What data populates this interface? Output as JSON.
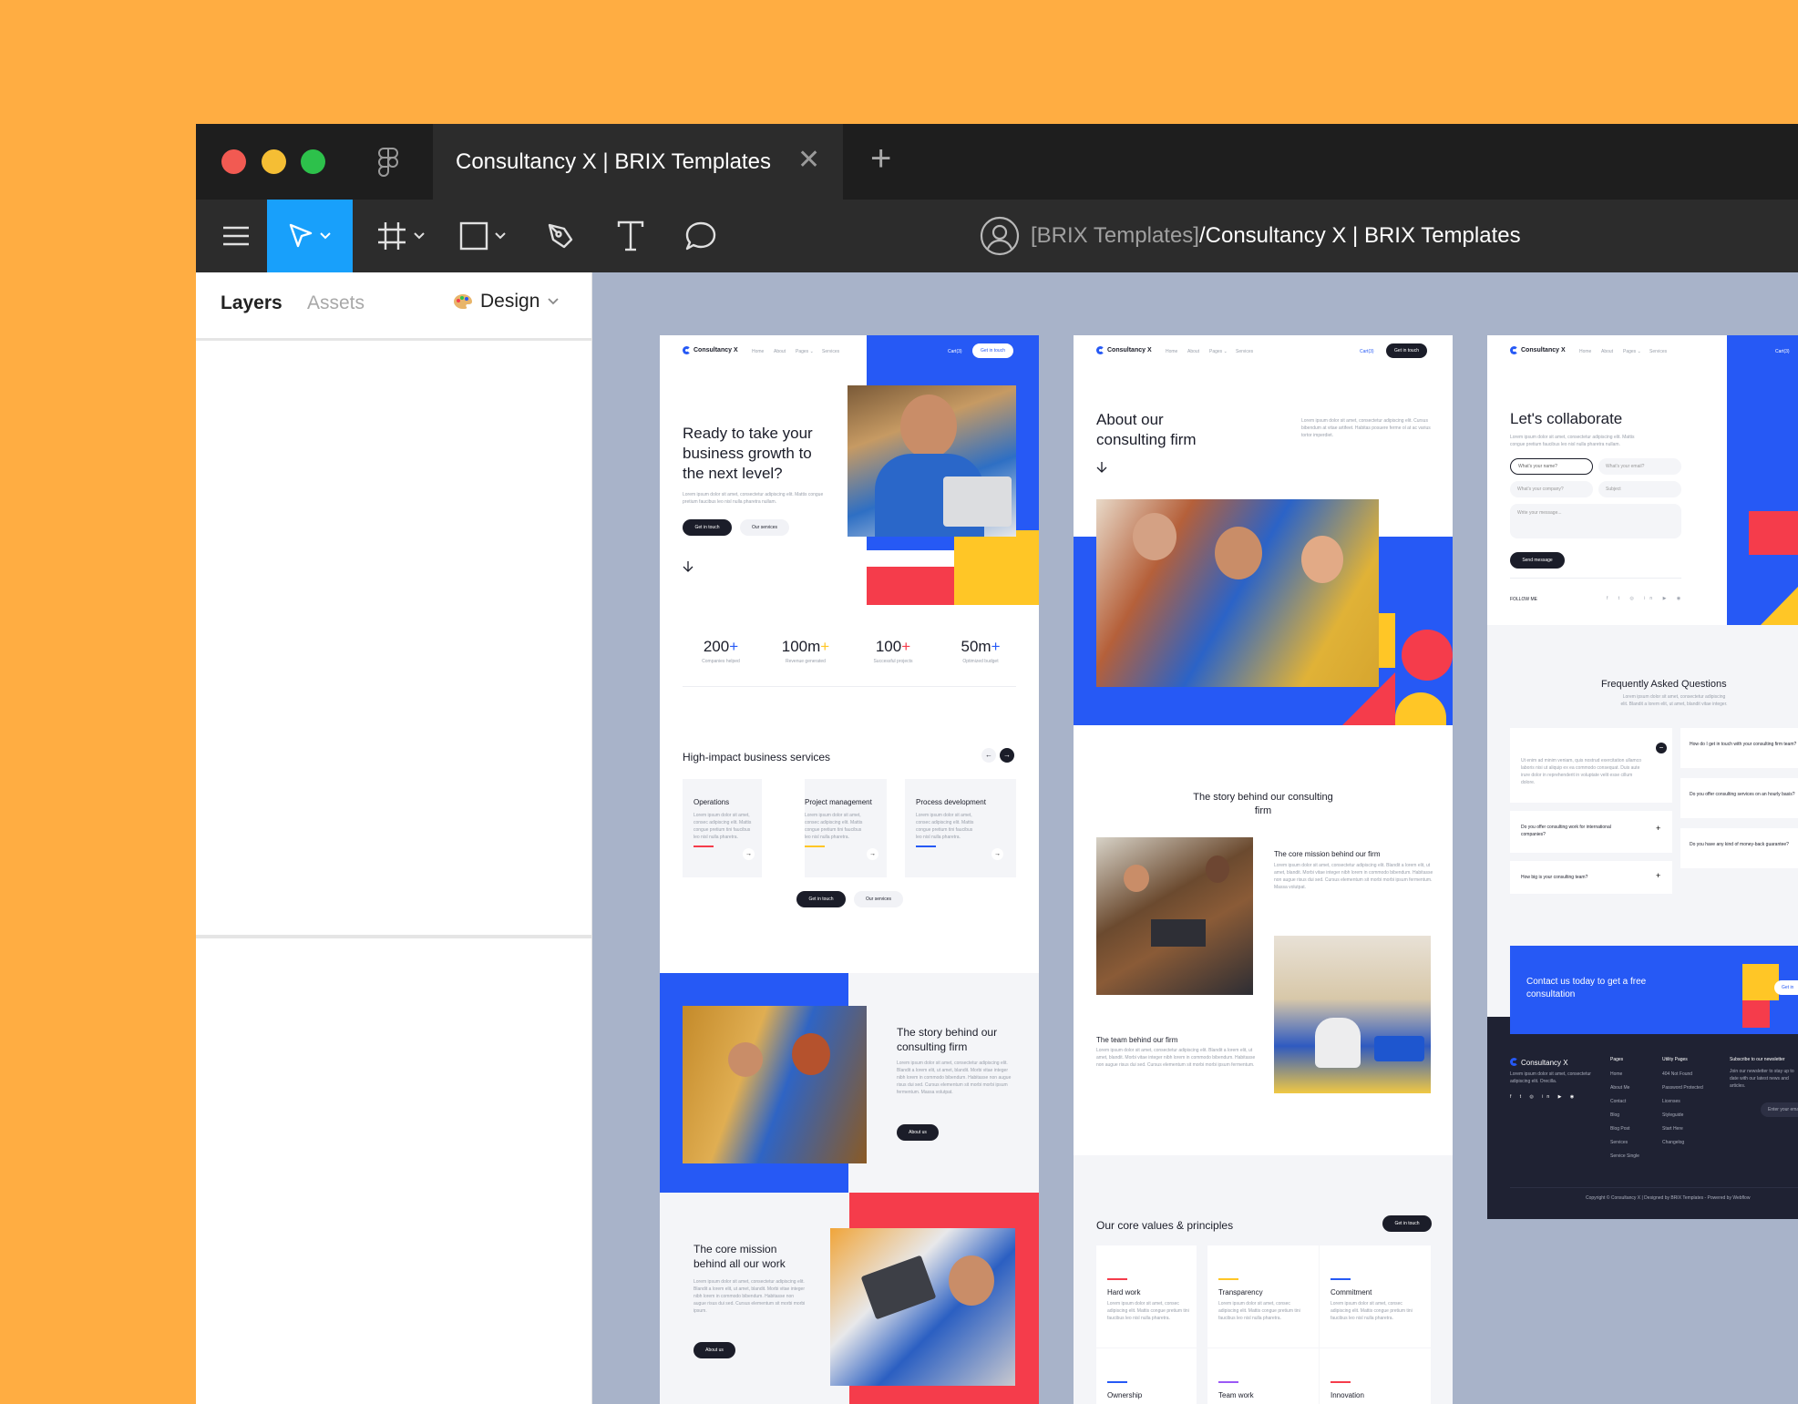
{
  "window": {
    "tab_title": "Consultancy X | BRIX Templates",
    "tab_close": "✕",
    "tab_add": "+"
  },
  "toolbar": {
    "breadcrumb_team": "[BRIX Templates]",
    "breadcrumb_file": "/Consultancy X | BRIX Templates"
  },
  "left_panel": {
    "tabs": [
      "Layers",
      "Assets"
    ],
    "design_label": "Design"
  },
  "frame1": {
    "brand": "Consultancy X",
    "nav": [
      "Home",
      "About",
      "Pages ⌄",
      "Services"
    ],
    "cart": "Cart(3)",
    "cta": "Get in touch",
    "hero_title": "Ready to take your business growth to the next level?",
    "hero_text": "Lorem ipsum dolor sit amet, consectetur adipiscing elit. Mattis congue pretium faucibus leo nisl nulla pharetra nullam.",
    "btn_primary": "Get in touch",
    "btn_secondary": "Our services",
    "stats": [
      {
        "value": "200",
        "suffix": "+",
        "label": "Companies helped"
      },
      {
        "value": "100m",
        "suffix": "+",
        "label": "Revenue generated"
      },
      {
        "value": "100",
        "suffix": "+",
        "label": "Successful projects"
      },
      {
        "value": "50m",
        "suffix": "+",
        "label": "Optimized budget"
      }
    ],
    "services_title": "High-impact business services",
    "services": [
      {
        "title": "Operations",
        "text": "Lorem ipsum dolor sit amet, consec adipiscing elit. Mattis congue pretium tini faucibus leo nisl nulla pharetra."
      },
      {
        "title": "Project management",
        "text": "Lorem ipsum dolor sit amet, consec adipiscing elit. Mattis congue pretium tini faucibus leo nisl nulla pharetra."
      },
      {
        "title": "Process development",
        "text": "Lorem ipsum dolor sit amet, consec adipiscing elit. Mattis congue pretium tini faucibus leo nisl nulla pharetra."
      }
    ],
    "services_btn_primary": "Get in touch",
    "services_btn_secondary": "Our services",
    "story_title": "The story behind our consulting firm",
    "story_text": "Lorem ipsum dolor sit amet, consectetur adipiscing elit. Blandit a lorem elit, ut amet, blandit. Morbi vitae integer nibh lorem in commodo bibendum. Habitasse non augue risus dui sed. Cursus elementum sit morbi morbi ipsum fermentum. Massa volutpat.",
    "story_btn": "About us",
    "mission_title": "The core mission behind all our work",
    "mission_text": "Lorem ipsum dolor sit amet, consectetur adipiscing elit. Blandit a lorem elit, ut amet, blandit. Morbi vitae integer nibh lorem in commodo bibendum. Habitasse non augue risus dui sed. Cursus elementum sit morbi morbi ipsum.",
    "mission_btn": "About us"
  },
  "frame2": {
    "brand": "Consultancy X",
    "nav": [
      "Home",
      "About",
      "Pages ⌄",
      "Services"
    ],
    "cart": "Cart(3)",
    "cta": "Get in touch",
    "title": "About our consulting firm",
    "intro": "Lorem ipsum dolor sit amet, consectetur adipiscing elit. Cursus bibendum at vitae artifeet. Habitas posuere ferme ol at ac varius tortor imperdiet.",
    "story_title": "The story behind our consulting firm",
    "mission_title": "The core mission behind our firm",
    "mission_text": "Lorem ipsum dolor sit amet, consectetur adipiscing elit. Blandit a lorem elit, ut amet, blandit. Morbi vitae integer nibh lorem in commodo bibendum. Habitasse non augue risus dui sed. Cursus elementum sit morbi morbi ipsum fermentum. Massa volutpat.",
    "team_title": "The team behind our firm",
    "team_text": "Lorem ipsum dolor sit amet, consectetur adipiscing elit. Blandit a lorem elit, ut amet, blandit. Morbi vitae integer nibh lorem in commodo bibendum. Habitasse non augue risus dui sed. Cursus elementum sit morbi morbi ipsum fermentum.",
    "values_title": "Our core values & principles",
    "values_btn": "Get in touch",
    "values": [
      {
        "title": "Hard work",
        "text": "Lorem ipsum dolor sit amet, consec adipiscing elit. Mattis congue pretium tini faucibus leo nisl nulla pharetra.",
        "color": "#F53C4B"
      },
      {
        "title": "Transparency",
        "text": "Lorem ipsum dolor sit amet, consec adipiscing elit. Mattis congue pretium tini faucibus leo nisl nulla pharetra.",
        "color": "#FFC626"
      },
      {
        "title": "Commitment",
        "text": "Lorem ipsum dolor sit amet, consec adipiscing elit. Mattis congue pretium tini faucibus leo nisl nulla pharetra.",
        "color": "#2659F5"
      },
      {
        "title": "Ownership",
        "color": "#2659F5"
      },
      {
        "title": "Team work",
        "color": "#9B59F5"
      },
      {
        "title": "Innovation",
        "color": "#F53C4B"
      }
    ]
  },
  "frame3": {
    "brand": "Consultancy X",
    "nav": [
      "Home",
      "About",
      "Pages ⌄",
      "Services"
    ],
    "cart": "Cart(3)",
    "title": "Let's collaborate",
    "intro": "Lorem ipsum dolor sit amet, consectetur adipiscing elit. Mattis congue pretium faucibus leo nisl nulla pharetra nullam.",
    "fields": [
      "What's your name?",
      "What's your email?",
      "What's your company?",
      "Subject",
      "Write your message..."
    ],
    "send_btn": "Send message",
    "follow": "FOLLOW ME",
    "faq_title": "Frequently Asked Questions",
    "faq_intro": "Lorem ipsum dolor sit amet, consectetur adipiscing elit. Blandit a lorem elit, ut amet, blandit vitae integer.",
    "faq_open_text": "Ut enim ad minim veniam, quis nostrud exercitation ullamco laboris nisi ut aliquip ex ea commodo consequat. Duis aute irure dolor in reprehenderit in voluptate velit esse cillum dolore.",
    "faq_left": [
      "Do you offer consulting work for international companies?",
      "How big is your consulting team?"
    ],
    "faq_right": [
      "How do I get in touch with your consulting firm team?",
      "Do you offer consulting services on an hourly basis?",
      "Do you have any kind of money-back guarantee?"
    ],
    "cta_title": "Contact us today to get a free consultation",
    "cta_btn": "Get in",
    "footer_brand": "Consultancy X",
    "footer_text": "Lorem ipsum dolor sit amet, consectetur adipiscing elit. Orecilla.",
    "footer_pages_title": "Pages",
    "footer_pages": [
      "Home",
      "About Me",
      "Contact",
      "Blog",
      "Blog Post",
      "Services",
      "Service Single"
    ],
    "footer_utility_title": "Utility Pages",
    "footer_utility": [
      "404 Not Found",
      "Password Protected",
      "Licenses",
      "Styleguide",
      "Start Here",
      "Changelog"
    ],
    "footer_news_title": "Subscribe to our newsletter",
    "footer_news_text": "Join our newsletter to stay up to date with our latest news and articles.",
    "footer_email_placeholder": "Enter your email",
    "copyright": "Copyright © Consultancy X | Designed by BRIX Templates - Powered by Webflow"
  },
  "colors": {
    "accent_blue": "#2659F5",
    "accent_red": "#F53C4B",
    "accent_yellow": "#FFC626",
    "figma_selected": "#18A0FB",
    "background": "#FFAD42",
    "canvas": "#A8B3C9"
  },
  "icons": [
    "figma-logo-icon",
    "menu-icon",
    "move-tool-icon",
    "frame-tool-icon",
    "shape-tool-icon",
    "pen-tool-icon",
    "text-tool-icon",
    "comment-tool-icon",
    "avatar-icon",
    "chevron-down-icon",
    "palette-icon"
  ]
}
